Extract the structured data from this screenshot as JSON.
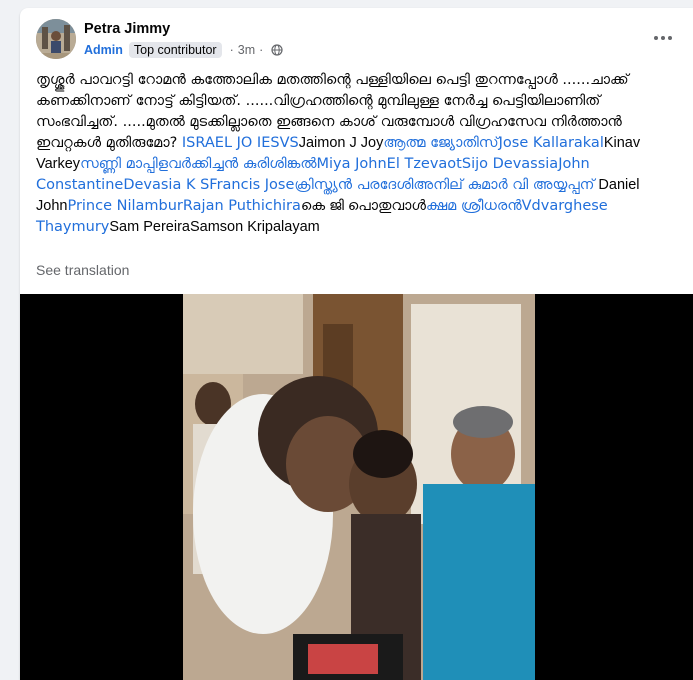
{
  "post": {
    "author": "Petra Jimmy",
    "role": "Admin",
    "badge": "Top contributor",
    "separator": "·",
    "time": "3m",
    "text_intro": "തൃശ്ശൂർ പാവറട്ടി റോമൻ കത്തോലിക മതത്തിന്റെ പള്ളിയിലെ പെട്ടി തുറന്നപ്പോൾ ......ചാക്ക് കണക്കിനാണ് നോട്ട് കിട്ടിയത്. ......വിഗ്രഹത്തിന്റെ മുമ്പിലുള്ള നേർച്ച പെട്ടിയിലാണിത് സംഭവിച്ചത്. .....മുതൽ മുടക്കില്ലാതെ ഇങ്ങനെ കാശ് വരുമ്പോൾ വിഗ്രഹസേവ നിർത്താൻ ഇവറ്റകൾ മുതിരുമോ? ",
    "tags": [
      {
        "text": "ISRAEL JO IESVS",
        "linked": true
      },
      {
        "text": "Jaimon J Joy",
        "linked": false
      },
      {
        "text": "ആത്മ ജ്യോതിസ്",
        "linked": true
      },
      {
        "text": "Jose Kallarakal",
        "linked": true
      },
      {
        "text": "Kinav Varkey",
        "linked": false
      },
      {
        "text": "സണ്ണി മാപ്പിളവർക്കിച്ചൻ കുരിശിങ്കൽ",
        "linked": true
      },
      {
        "text": "Miya John",
        "linked": true
      },
      {
        "text": "El Tzevaot",
        "linked": true
      },
      {
        "text": "Sijo Devassia",
        "linked": true
      },
      {
        "text": "John Constantine",
        "linked": true
      },
      {
        "text": "Devasia K SFrancis Jose",
        "linked": true
      },
      {
        "text": "ക്രിസ്ത്യൻ പരദേശി",
        "linked": true
      },
      {
        "text": "അനില് കുമാർ വി അയ്യപ്പന്",
        "linked": true
      },
      {
        "text": " Daniel John",
        "linked": false
      },
      {
        "text": "Prince Nilambur",
        "linked": true
      },
      {
        "text": "Rajan Puthichira",
        "linked": true
      },
      {
        "text": "കെ ജി പൊതുവാൾ",
        "linked": false
      },
      {
        "text": "ക്ഷമ ശ്രീധരൻ",
        "linked": true
      },
      {
        "text": "Vdvarghese Thaymury",
        "linked": true
      },
      {
        "text": "Sam Pereira",
        "linked": false
      },
      {
        "text": "Samson Kripalayam",
        "linked": false
      }
    ],
    "see_translation": "See translation"
  },
  "icons": {
    "more": "more-options-icon",
    "privacy": "globe-icon"
  },
  "colors": {
    "link": "#216fdb",
    "secondary_text": "#65676b",
    "badge_bg": "#e4e6eb",
    "page_bg": "#f0f2f5",
    "media_bg": "#000000"
  }
}
